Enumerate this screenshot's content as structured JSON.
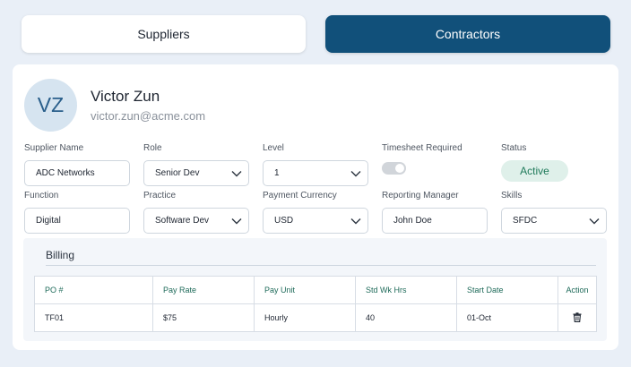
{
  "tabs": {
    "suppliers": "Suppliers",
    "contractors": "Contractors"
  },
  "profile": {
    "initials": "VZ",
    "name": "Victor Zun",
    "email": "victor.zun@acme.com"
  },
  "fields": {
    "supplier_name": {
      "label": "Supplier Name",
      "value": "ADC Networks"
    },
    "role": {
      "label": "Role",
      "value": "Senior Dev"
    },
    "level": {
      "label": "Level",
      "value": "1"
    },
    "timesheet_required": {
      "label": "Timesheet Required",
      "value": "off"
    },
    "status": {
      "label": "Status",
      "value": "Active"
    },
    "function": {
      "label": "Function",
      "value": "Digital"
    },
    "practice": {
      "label": "Practice",
      "value": "Software Dev"
    },
    "payment_currency": {
      "label": "Payment Currency",
      "value": "USD"
    },
    "reporting_manager": {
      "label": "Reporting Manager",
      "value": "John Doe"
    },
    "skills": {
      "label": "Skills",
      "value": "SFDC"
    }
  },
  "billing": {
    "title": "Billing",
    "columns": [
      "PO #",
      "Pay Rate",
      "Pay Unit",
      "Std Wk Hrs",
      "Start Date",
      "Action"
    ],
    "rows": [
      {
        "po": "TF01",
        "pay_rate": "$75",
        "pay_unit": "Hourly",
        "std_wk_hrs": "40",
        "start_date": "01-Oct"
      }
    ]
  },
  "icons": {
    "dropdown": "chevron-down-icon",
    "action": "trash-icon"
  },
  "colors": {
    "accent": "#11507a",
    "status_active_bg": "#dff0ea",
    "status_active_text": "#1f7a5a",
    "table_header_text": "#1f6b5a"
  }
}
